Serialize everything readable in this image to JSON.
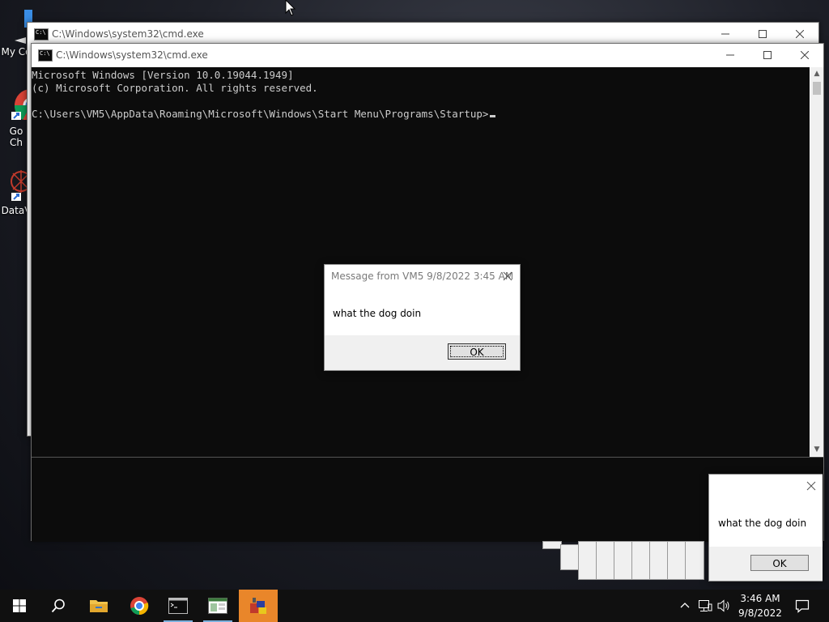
{
  "desktop": {
    "icons": [
      {
        "label": "My Co",
        "name": "my-computer"
      },
      {
        "label": "Go\nCh",
        "name": "google-chrome"
      },
      {
        "label": "DataV",
        "name": "datav"
      }
    ]
  },
  "cmd_back": {
    "title": "C:\\Windows\\system32\\cmd.exe"
  },
  "cmd_front": {
    "title": "C:\\Windows\\system32\\cmd.exe",
    "lines": [
      "Microsoft Windows [Version 10.0.19044.1949]",
      "(c) Microsoft Corporation. All rights reserved.",
      "",
      "C:\\Users\\VM5\\AppData\\Roaming\\Microsoft\\Windows\\Start Menu\\Programs\\Startup>"
    ]
  },
  "message_main": {
    "title": "Message from VM5 9/8/2022 3:45 AM",
    "text": "what the dog doin",
    "ok_label": "OK"
  },
  "message_corner": {
    "text": "what the dog doin",
    "ok_label": "OK"
  },
  "taskbar": {
    "items": [
      {
        "name": "start-button",
        "icon": "windows-logo-icon"
      },
      {
        "name": "search-button",
        "icon": "search-icon"
      },
      {
        "name": "file-explorer-button",
        "icon": "folder-icon"
      },
      {
        "name": "chrome-button",
        "icon": "chrome-icon"
      },
      {
        "name": "cmd-button",
        "icon": "cmd-icon"
      },
      {
        "name": "app-button",
        "icon": "window-app-icon"
      },
      {
        "name": "msg-app-button",
        "icon": "msg-app-icon"
      }
    ],
    "time": "3:46 AM",
    "date": "9/8/2022"
  },
  "colors": {
    "accent_active": "#e9862a",
    "console_bg": "#0c0c0c",
    "console_fg": "#cccccc",
    "taskbar_bg": "#101010"
  }
}
